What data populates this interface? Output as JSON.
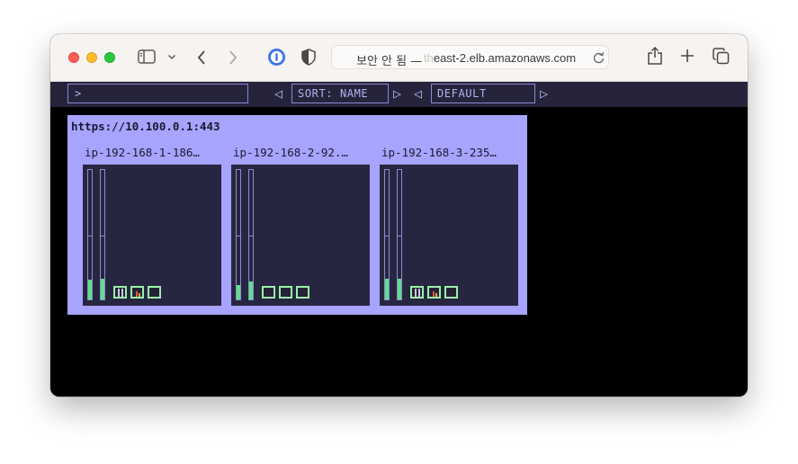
{
  "browser": {
    "security_label": "보안 안 됨 —",
    "url_faded_prefix": "th",
    "url_host": "east-2.elb.amazonaws.com",
    "icons": [
      "sidebar-icon",
      "chevron-down-icon",
      "back-icon",
      "forward-icon",
      "password-manager-icon",
      "shield-icon",
      "reload-icon",
      "share-icon",
      "new-tab-icon",
      "tabs-overview-icon"
    ]
  },
  "toolbar": {
    "command_prompt": ">",
    "sort_label": "SORT: NAME",
    "view_label": "DEFAULT",
    "prev_glyph": "◁",
    "next_glyph": "▷"
  },
  "endpoint": {
    "url": "https://10.100.0.1:443",
    "nodes": [
      {
        "name": "ip-192-168-1-186…",
        "gauge1_level": 0.15,
        "gauge2_level": 0.16
      },
      {
        "name": "ip-192-168-2-92.…",
        "gauge1_level": 0.11,
        "gauge2_level": 0.14
      },
      {
        "name": "ip-192-168-3-235…",
        "gauge1_level": 0.16,
        "gauge2_level": 0.16
      }
    ]
  },
  "colors": {
    "panel": "#a7a4ff",
    "tile_bg": "#272640",
    "usage_fill": "#5fe08a",
    "chip_border": "#9bf0a8",
    "topbar": "#26243a"
  }
}
